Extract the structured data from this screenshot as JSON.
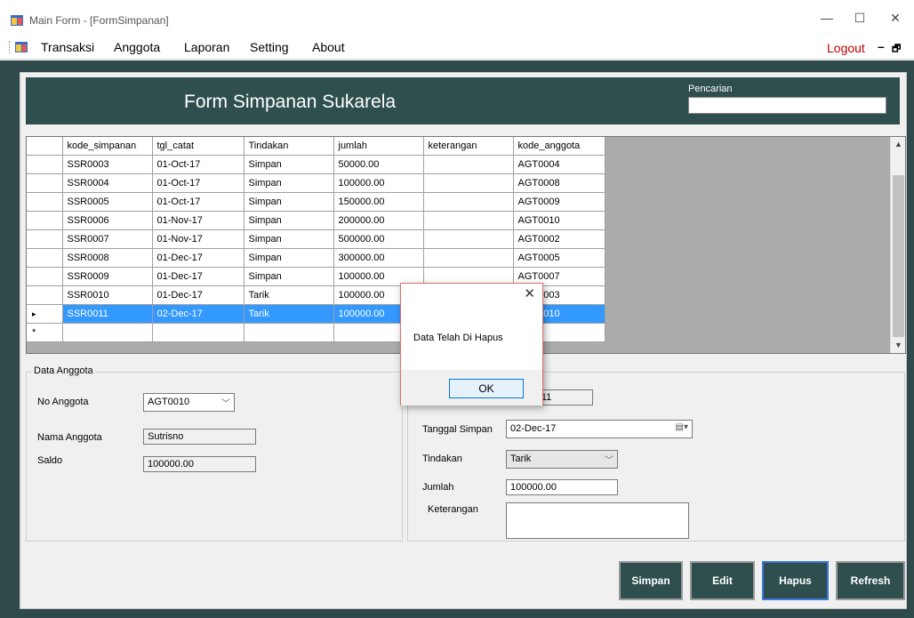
{
  "window": {
    "title": "Main Form - [FormSimpanan]"
  },
  "menu": {
    "items": [
      "Transaksi",
      "Anggota",
      "Laporan",
      "Setting",
      "About"
    ],
    "logout": "Logout",
    "mdi_minimize": "–",
    "mdi_restore": "🗗"
  },
  "header": {
    "title": "Form Simpanan Sukarela",
    "search_label": "Pencarian",
    "search_value": ""
  },
  "grid": {
    "columns": [
      "kode_simpanan",
      "tgl_catat",
      "Tindakan",
      "jumlah",
      "keterangan",
      "kode_anggota"
    ],
    "rows": [
      [
        "SSR0003",
        "01-Oct-17",
        "Simpan",
        "50000.00",
        "",
        "AGT0004"
      ],
      [
        "SSR0004",
        "01-Oct-17",
        "Simpan",
        "100000.00",
        "",
        "AGT0008"
      ],
      [
        "SSR0005",
        "01-Oct-17",
        "Simpan",
        "150000.00",
        "",
        "AGT0009"
      ],
      [
        "SSR0006",
        "01-Nov-17",
        "Simpan",
        "200000.00",
        "",
        "AGT0010"
      ],
      [
        "SSR0007",
        "01-Nov-17",
        "Simpan",
        "500000.00",
        "",
        "AGT0002"
      ],
      [
        "SSR0008",
        "01-Dec-17",
        "Simpan",
        "300000.00",
        "",
        "AGT0005"
      ],
      [
        "SSR0009",
        "01-Dec-17",
        "Simpan",
        "100000.00",
        "",
        "AGT0007"
      ],
      [
        "SSR0010",
        "01-Dec-17",
        "Tarik",
        "100000.00",
        "",
        "AGT0003"
      ],
      [
        "SSR0011",
        "02-Dec-17",
        "Tarik",
        "100000.00",
        "",
        "AGT0010"
      ]
    ],
    "selected_row_index": 8,
    "current_row_marker": "▸",
    "new_row_marker": "*"
  },
  "anggota": {
    "legend": "Data Anggota",
    "no_label": "No Anggota",
    "no_value": "AGT0010",
    "nama_label": "Nama Anggota",
    "nama_value": "Sutrisno",
    "saldo_label": "Saldo",
    "saldo_value": "100000.00"
  },
  "simpanan": {
    "kode_value": "SSR0011",
    "tanggal_label": "Tanggal Simpan",
    "tanggal_value": "02-Dec-17",
    "tindakan_label": "Tindakan",
    "tindakan_value": "Tarik",
    "jumlah_label": "Jumlah",
    "jumlah_value": "100000.00",
    "keterangan_label": "Keterangan",
    "keterangan_value": ""
  },
  "buttons": {
    "simpan": "Simpan",
    "edit": "Edit",
    "hapus": "Hapus",
    "refresh": "Refresh"
  },
  "dialog": {
    "message": "Data Telah Di Hapus",
    "ok": "OK"
  },
  "colors": {
    "header_bg": "#2f4f4f",
    "selection": "#3399ff",
    "logout": "#c00000"
  }
}
